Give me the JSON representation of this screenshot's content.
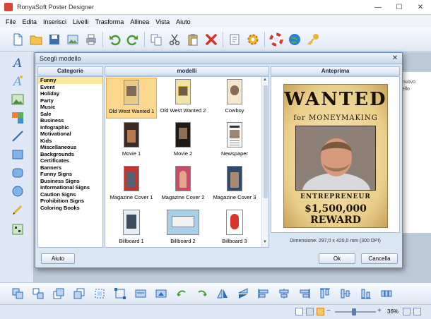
{
  "window": {
    "title": "RonyaSoft Poster Designer",
    "min_symbol": "—",
    "max_symbol": "☐",
    "close_symbol": "✕"
  },
  "menu": [
    "File",
    "Edita",
    "Inserisci",
    "Livelli",
    "Trasforma",
    "Allinea",
    "Vista",
    "Aiuto"
  ],
  "right_panel_text": [
    "nuovo",
    "ello"
  ],
  "dialog": {
    "title": "Scegli modello",
    "close_symbol": "✕",
    "col_categories": "Categorie",
    "col_models": "modelli",
    "col_preview": "Anteprima",
    "categories": [
      "Funny",
      "Event",
      "Holiday",
      "Party",
      "Music",
      "Sale",
      "Business",
      "Infographic",
      "Motivational",
      "Kids",
      "Miscellaneous",
      "Backgrounds",
      "Certificates",
      "Banners",
      "Funny Signs",
      "Business Signs",
      "Informational Signs",
      "Caution Signs",
      "Prohibition Signs",
      "Coloring Books"
    ],
    "selected_category": "Funny",
    "models": [
      "Old West Wanted 1",
      "Old West Wanted 2",
      "Cowboy",
      "Movie 1",
      "Movie 2",
      "Newspaper",
      "Magazine Cover 1",
      "Magazine Cover 2",
      "Magazine Cover 3",
      "Billboard 1",
      "Billboard 2",
      "Billboard 3"
    ],
    "selected_model": "Old West Wanted 1",
    "preview": {
      "wanted": "WANTED",
      "for_line": "for MONEYMAKING",
      "name_line": "ENTREPRENEUR",
      "reward_line": "$1,500,000 REWARD"
    },
    "dimensions": "Dimensione: 297,0 x 420,0 mm (300 DPI)",
    "help_button": "Aiuto",
    "ok_button": "Ok",
    "cancel_button": "Cancella"
  },
  "status": {
    "zoom": "36%"
  },
  "colors": {
    "accent_selection": "#fbd88e",
    "category_selection": "#fbe79f",
    "app_background": "#dfe8f4",
    "dialog_border": "#6b88ad"
  }
}
